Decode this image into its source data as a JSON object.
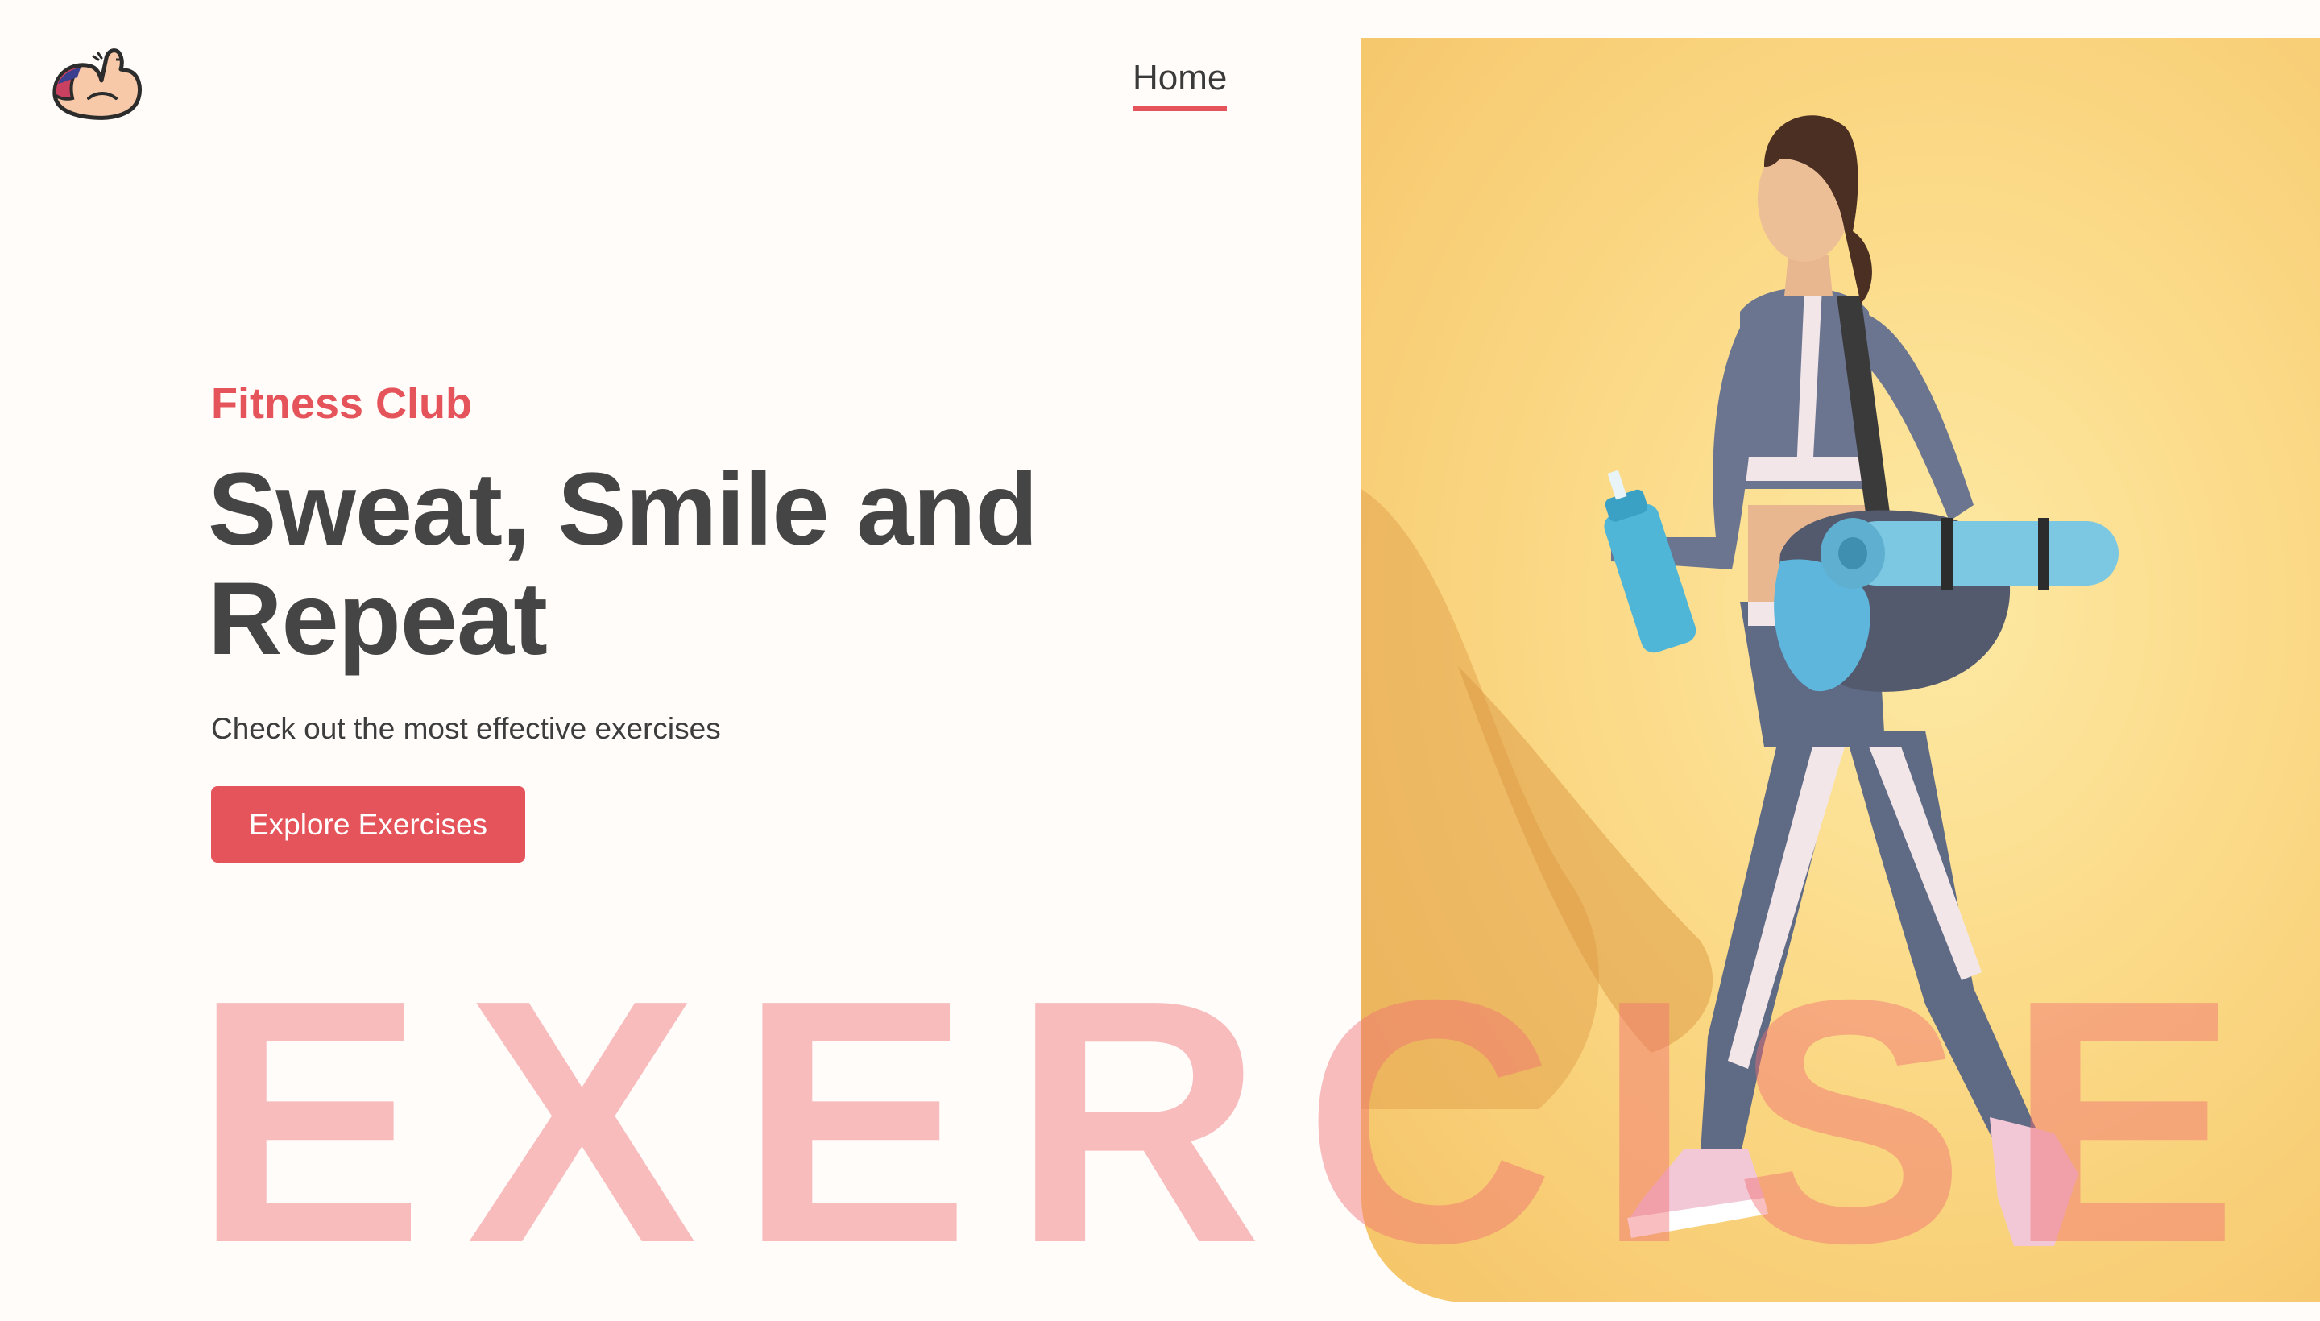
{
  "nav": {
    "logo_icon": "flexed-bicep-icon",
    "home_label": "Home",
    "active_color": "#e5545a"
  },
  "hero": {
    "eyebrow": "Fitness Club",
    "headline_line1": "Sweat, Smile and",
    "headline_line2": "Repeat",
    "subtitle": "Check out the most effective exercises",
    "cta_label": "Explore Exercises"
  },
  "banner": {
    "watermark_text": "EXERCISE",
    "photo_subject": "woman-walking-with-yoga-mat-and-water-bottle"
  },
  "colors": {
    "accent": "#e5545a",
    "text": "#454545",
    "background": "#fffcfa",
    "photo_background": "#fbd986"
  }
}
